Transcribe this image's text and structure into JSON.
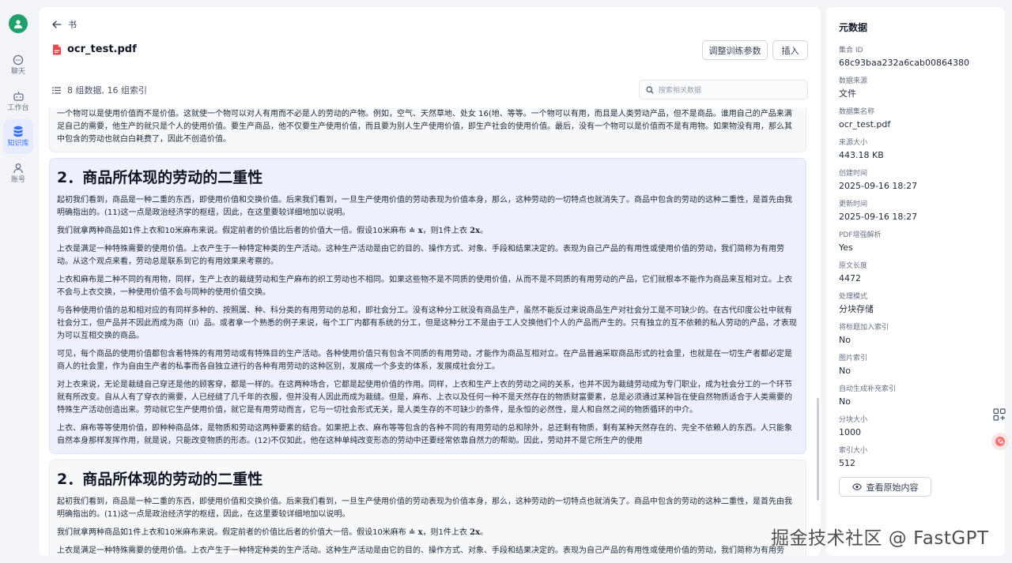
{
  "nav": {
    "items": [
      {
        "label": "聊天",
        "icon": "chat-icon"
      },
      {
        "label": "工作台",
        "icon": "robot-icon"
      },
      {
        "label": "知识库",
        "icon": "database-icon"
      },
      {
        "label": "账号",
        "icon": "user-icon"
      }
    ],
    "active_index": 2,
    "accent": "#3370ff"
  },
  "header": {
    "back_label": "书",
    "file_name": "ocr_test.pdf",
    "adjust_button": "调整训练参数",
    "insert_button": "插入",
    "count_text": "8 组数据, 16 组索引",
    "search_placeholder": "搜索相关数据"
  },
  "chunks": [
    {
      "title": "",
      "paragraphs": [
        "一个物可以是使用价值而不是价值。这就使一个物可以对人有用而不必是人的劳动的产物。例如，空气、天然草地、处女 16(地、等等。一个物可以有用，而且是人类劳动产品，但不是商品。谁用自己的产品来满足自己的需要，他生产的就只是个人的使用价值。要生产商品，他不仅要生产使用价值，而且要为别人生产使用价值，即生产社会的使用价值。最后，没有一个物可以是价值而不是有用物。如果物没有用，那么其中包含的劳动也就白白耗费了，因此不创造价值。"
      ]
    },
    {
      "title": "2．商品所体现的劳动的二重性",
      "para1": "起初我们看到，商品是一种二重的东西，即使用价值和交换价值。后来我们看到，一旦生产使用价值的劳动表现为价值本身，那么，这种劳动的一切特点也就消失了。商品中包含的劳动的这种二重性，是首先由我明确指出的。(11)这一点是政治经济学的枢纽，因此，在这里要较详细地加以说明。",
      "para2_before": "我们就拿两种商品如1件上衣和10米麻布来说。假定前者的价值比后者的价值大一倍。假设10米麻布",
      "para2_eq": "≐",
      "para2_x": "x",
      "para2_mid": "，则1件上衣",
      "para2_2x": "2x",
      "para2_end": "。",
      "paragraphs": [
        "上衣是满足一种特殊需要的使用价值。上衣产生于一种特定种类的生产活动。这种生产活动是由它的目的、操作方式、对象、手段和结果决定的。表现为自己产品的有用性或使用价值的劳动，我们简称为有用劳动。从这个观点来看，劳动总是联系到它的有用效果来考察的。",
        "上衣和麻布是二种不同的有用物，同样，生产上衣的裁缝劳动和生产麻布的织工劳动也不相同。如果这些物不是不同质的使用价值，从而不是不同质的有用劳动的产品，它们就根本不能作为商品来互相对立。上衣不会与上衣交换，一种使用价值不会与同种的使用价值交换。",
        "与各种使用价值的总和相对应的有同样多种的、按照属、种、科分类的有用劳动的总和，即社会分工。没有这种分工就没有商品生产，虽然不能反过来说商品生产对社会分工是不可缺少的。在古代印度公社中就有社会分工，但产品并不因此而成为商（II）品。或者拿一个熟悉的例子来说，每个工厂内都有系统的分工，但是这种分工不是由于工人交换他们个人的产品而产生的。只有独立的互不依赖的私人劳动的产品，才表现为可以互相交换的商品。",
        "可见，每个商品的使用价值都包含着特殊的有用劳动或有特殊目的生产活动。各种使用价值只有包含不同质的有用劳动，才能作为商品互相对立。在产品普遍采取商品形式的社会里，也就是在一切生产者都必定是商人的社会里，作为自由生产者的私事而各自独立进行的各种有用劳动的这种区别，发展成一个多支的体系，发展成社会分工。",
        "对上衣来说，无论是裁缝自己穿还是他的顾客穿，都是一样的。在这两种场合，它都是起使用价值的作用。同样，上衣和生产上衣的劳动之间的关系，也并不因为裁缝劳动成为专门职业，成为社会分工的一个环节就有所改变。自从人有了穿衣的需要，人已经缝了几千年的衣服，但并没有人因此而成为裁缝。但是，麻布、上衣以及任何一种不是天然存在的物质财富要素，总是必须通过某种旨在使自然物质适合于人类需要的特殊生产活动创造出来。劳动就它生产使用价值，就它是有用劳动而言，它与一切社会形式无关，是人类生存的不可缺少的条件，是永恒的必然性，是人和自然之间的物质循环的中介。",
        "上衣、麻布等等使用价值，即种种商品体，是物质和劳动这两种要素的结合。如果把上衣、麻布等等包含的各种不同的有用劳动的总和除外，总还剩有物质，剩有某种天然存在的、完全不依赖人的东西。人只能象自然本身那样发挥作用，就是说，只能改变物质的形态。(12)不仅如此，他在这种单纯改变形态的劳动中还要经常依靠自然力的帮助。因此，劳动并不是它所生产的使用"
      ]
    },
    {
      "title": "2．商品所体现的劳动的二重性",
      "para1": "起初我们看到，商品是一种二重的东西，即使用价值和交换价值。后来我们看到，一旦生产使用价值的劳动表现为价值本身，那么，这种劳动的一切特点也就消失了。商品中包含的劳动的这种二重性，是首先由我明确指出的。(11)这一点是政治经济学的枢纽，因此，在这里要较详细地加以说明。",
      "para2_before": "我们就拿两种商品如1件上衣和10米麻布来说。假定前者的价值比后者的价值大一倍。假设10米麻布",
      "para2_eq": "≐",
      "para2_x": "x",
      "para2_mid": "，则1件上衣",
      "para2_2x": "2x",
      "para2_end": "。",
      "cut_paragraph": "上衣是满足一种特殊需要的使用价值。上衣产生于一种特定种类的生产活动。这种生产活动是由它的目的、操作方式、对象、手段和结果决定的。表现为自己产品的有用性或使用价值的劳动，我们简称为有用劳动。"
    }
  ],
  "metadata": {
    "title": "元数据",
    "fields": [
      {
        "label": "集合 ID",
        "value": "68c93baa232a6cab00864380"
      },
      {
        "label": "数据来源",
        "value": "文件"
      },
      {
        "label": "数据集名称",
        "value": "ocr_test.pdf"
      },
      {
        "label": "来源大小",
        "value": "443.18 KB"
      },
      {
        "label": "创建时间",
        "value": "2025-09-16 18:27"
      },
      {
        "label": "更新时间",
        "value": "2025-09-16 18:27"
      },
      {
        "label": "PDF增强解析",
        "value": "Yes"
      },
      {
        "label": "原文长度",
        "value": "4472"
      },
      {
        "label": "处理模式",
        "value": "分块存储"
      },
      {
        "label": "将标题加入索引",
        "value": "No"
      },
      {
        "label": "图片索引",
        "value": "No"
      },
      {
        "label": "自动生成补充索引",
        "value": "No"
      },
      {
        "label": "分块大小",
        "value": "1000"
      },
      {
        "label": "索引大小",
        "value": "512"
      }
    ],
    "view_button": "查看原始内容"
  },
  "watermark": "掘金技术社区 @ FastGPT",
  "colors": {
    "accent": "#3370ff",
    "highlight_chunk": "#eef1fc",
    "avatar": "#22a06b",
    "pdf_red": "#e5484d"
  }
}
